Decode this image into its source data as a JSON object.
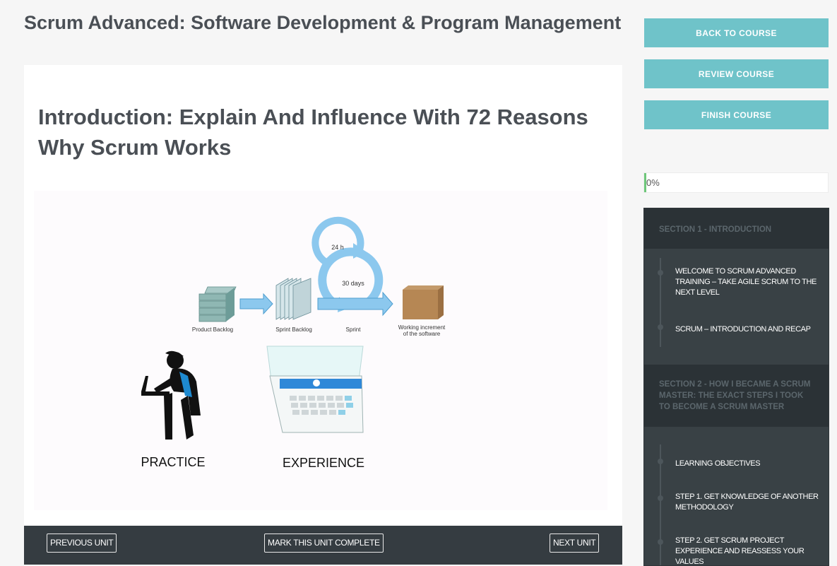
{
  "course": {
    "title": "Scrum Advanced: Software Development & Program Management"
  },
  "unit": {
    "title": "Introduction: Explain And Influence With 72 Reasons Why Scrum Works"
  },
  "figure": {
    "labels": {
      "cycle_24h": "24 h",
      "cycle_30d": "30 days",
      "product_backlog": "Product Backlog",
      "sprint_backlog": "Sprint Backlog",
      "sprint": "Sprint",
      "increment_line1": "Working increment",
      "increment_line2": "of the software",
      "practice": "PRACTICE",
      "experience": "EXPERIENCE"
    }
  },
  "navigation": {
    "previous": "PREVIOUS UNIT",
    "mark_complete": "MARK THIS UNIT COMPLETE",
    "next": "NEXT UNIT"
  },
  "sidebar": {
    "back": "Back to course",
    "review": "Review course",
    "finish": "Finish course",
    "progress": {
      "value": 0,
      "label": "0%",
      "color": "#6ec77a"
    },
    "accent_color": "#6fc3c9",
    "sections": [
      {
        "title": "SECTION 1 - INTRODUCTION",
        "units": [
          "WELCOME TO SCRUM ADVANCED TRAINING – TAKE AGILE SCRUM TO THE NEXT LEVEL",
          "SCRUM – INTRODUCTION AND RECAP"
        ]
      },
      {
        "title": "SECTION 2 - HOW I BECAME A SCRUM MASTER: THE EXACT STEPS I TOOK TO BECOME A SCRUM MASTER",
        "units": [
          "LEARNING OBJECTIVES",
          "STEP 1. GET KNOWLEDGE OF ANOTHER METHODOLOGY",
          "STEP 2. GET SCRUM PROJECT EXPERIENCE AND REASSESS YOUR VALUES"
        ]
      }
    ]
  }
}
